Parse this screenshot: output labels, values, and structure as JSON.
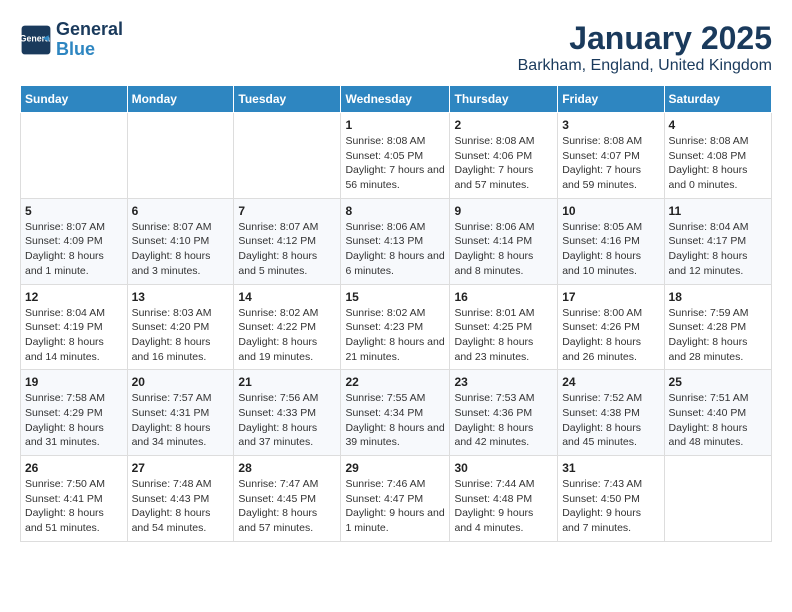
{
  "logo": {
    "text_general": "General",
    "text_blue": "Blue"
  },
  "title": "January 2025",
  "subtitle": "Barkham, England, United Kingdom",
  "days_of_week": [
    "Sunday",
    "Monday",
    "Tuesday",
    "Wednesday",
    "Thursday",
    "Friday",
    "Saturday"
  ],
  "weeks": [
    [
      {
        "day": null,
        "sunrise": null,
        "sunset": null,
        "daylight": null
      },
      {
        "day": null,
        "sunrise": null,
        "sunset": null,
        "daylight": null
      },
      {
        "day": null,
        "sunrise": null,
        "sunset": null,
        "daylight": null
      },
      {
        "day": "1",
        "sunrise": "Sunrise: 8:08 AM",
        "sunset": "Sunset: 4:05 PM",
        "daylight": "Daylight: 7 hours and 56 minutes."
      },
      {
        "day": "2",
        "sunrise": "Sunrise: 8:08 AM",
        "sunset": "Sunset: 4:06 PM",
        "daylight": "Daylight: 7 hours and 57 minutes."
      },
      {
        "day": "3",
        "sunrise": "Sunrise: 8:08 AM",
        "sunset": "Sunset: 4:07 PM",
        "daylight": "Daylight: 7 hours and 59 minutes."
      },
      {
        "day": "4",
        "sunrise": "Sunrise: 8:08 AM",
        "sunset": "Sunset: 4:08 PM",
        "daylight": "Daylight: 8 hours and 0 minutes."
      }
    ],
    [
      {
        "day": "5",
        "sunrise": "Sunrise: 8:07 AM",
        "sunset": "Sunset: 4:09 PM",
        "daylight": "Daylight: 8 hours and 1 minute."
      },
      {
        "day": "6",
        "sunrise": "Sunrise: 8:07 AM",
        "sunset": "Sunset: 4:10 PM",
        "daylight": "Daylight: 8 hours and 3 minutes."
      },
      {
        "day": "7",
        "sunrise": "Sunrise: 8:07 AM",
        "sunset": "Sunset: 4:12 PM",
        "daylight": "Daylight: 8 hours and 5 minutes."
      },
      {
        "day": "8",
        "sunrise": "Sunrise: 8:06 AM",
        "sunset": "Sunset: 4:13 PM",
        "daylight": "Daylight: 8 hours and 6 minutes."
      },
      {
        "day": "9",
        "sunrise": "Sunrise: 8:06 AM",
        "sunset": "Sunset: 4:14 PM",
        "daylight": "Daylight: 8 hours and 8 minutes."
      },
      {
        "day": "10",
        "sunrise": "Sunrise: 8:05 AM",
        "sunset": "Sunset: 4:16 PM",
        "daylight": "Daylight: 8 hours and 10 minutes."
      },
      {
        "day": "11",
        "sunrise": "Sunrise: 8:04 AM",
        "sunset": "Sunset: 4:17 PM",
        "daylight": "Daylight: 8 hours and 12 minutes."
      }
    ],
    [
      {
        "day": "12",
        "sunrise": "Sunrise: 8:04 AM",
        "sunset": "Sunset: 4:19 PM",
        "daylight": "Daylight: 8 hours and 14 minutes."
      },
      {
        "day": "13",
        "sunrise": "Sunrise: 8:03 AM",
        "sunset": "Sunset: 4:20 PM",
        "daylight": "Daylight: 8 hours and 16 minutes."
      },
      {
        "day": "14",
        "sunrise": "Sunrise: 8:02 AM",
        "sunset": "Sunset: 4:22 PM",
        "daylight": "Daylight: 8 hours and 19 minutes."
      },
      {
        "day": "15",
        "sunrise": "Sunrise: 8:02 AM",
        "sunset": "Sunset: 4:23 PM",
        "daylight": "Daylight: 8 hours and 21 minutes."
      },
      {
        "day": "16",
        "sunrise": "Sunrise: 8:01 AM",
        "sunset": "Sunset: 4:25 PM",
        "daylight": "Daylight: 8 hours and 23 minutes."
      },
      {
        "day": "17",
        "sunrise": "Sunrise: 8:00 AM",
        "sunset": "Sunset: 4:26 PM",
        "daylight": "Daylight: 8 hours and 26 minutes."
      },
      {
        "day": "18",
        "sunrise": "Sunrise: 7:59 AM",
        "sunset": "Sunset: 4:28 PM",
        "daylight": "Daylight: 8 hours and 28 minutes."
      }
    ],
    [
      {
        "day": "19",
        "sunrise": "Sunrise: 7:58 AM",
        "sunset": "Sunset: 4:29 PM",
        "daylight": "Daylight: 8 hours and 31 minutes."
      },
      {
        "day": "20",
        "sunrise": "Sunrise: 7:57 AM",
        "sunset": "Sunset: 4:31 PM",
        "daylight": "Daylight: 8 hours and 34 minutes."
      },
      {
        "day": "21",
        "sunrise": "Sunrise: 7:56 AM",
        "sunset": "Sunset: 4:33 PM",
        "daylight": "Daylight: 8 hours and 37 minutes."
      },
      {
        "day": "22",
        "sunrise": "Sunrise: 7:55 AM",
        "sunset": "Sunset: 4:34 PM",
        "daylight": "Daylight: 8 hours and 39 minutes."
      },
      {
        "day": "23",
        "sunrise": "Sunrise: 7:53 AM",
        "sunset": "Sunset: 4:36 PM",
        "daylight": "Daylight: 8 hours and 42 minutes."
      },
      {
        "day": "24",
        "sunrise": "Sunrise: 7:52 AM",
        "sunset": "Sunset: 4:38 PM",
        "daylight": "Daylight: 8 hours and 45 minutes."
      },
      {
        "day": "25",
        "sunrise": "Sunrise: 7:51 AM",
        "sunset": "Sunset: 4:40 PM",
        "daylight": "Daylight: 8 hours and 48 minutes."
      }
    ],
    [
      {
        "day": "26",
        "sunrise": "Sunrise: 7:50 AM",
        "sunset": "Sunset: 4:41 PM",
        "daylight": "Daylight: 8 hours and 51 minutes."
      },
      {
        "day": "27",
        "sunrise": "Sunrise: 7:48 AM",
        "sunset": "Sunset: 4:43 PM",
        "daylight": "Daylight: 8 hours and 54 minutes."
      },
      {
        "day": "28",
        "sunrise": "Sunrise: 7:47 AM",
        "sunset": "Sunset: 4:45 PM",
        "daylight": "Daylight: 8 hours and 57 minutes."
      },
      {
        "day": "29",
        "sunrise": "Sunrise: 7:46 AM",
        "sunset": "Sunset: 4:47 PM",
        "daylight": "Daylight: 9 hours and 1 minute."
      },
      {
        "day": "30",
        "sunrise": "Sunrise: 7:44 AM",
        "sunset": "Sunset: 4:48 PM",
        "daylight": "Daylight: 9 hours and 4 minutes."
      },
      {
        "day": "31",
        "sunrise": "Sunrise: 7:43 AM",
        "sunset": "Sunset: 4:50 PM",
        "daylight": "Daylight: 9 hours and 7 minutes."
      },
      {
        "day": null,
        "sunrise": null,
        "sunset": null,
        "daylight": null
      }
    ]
  ]
}
